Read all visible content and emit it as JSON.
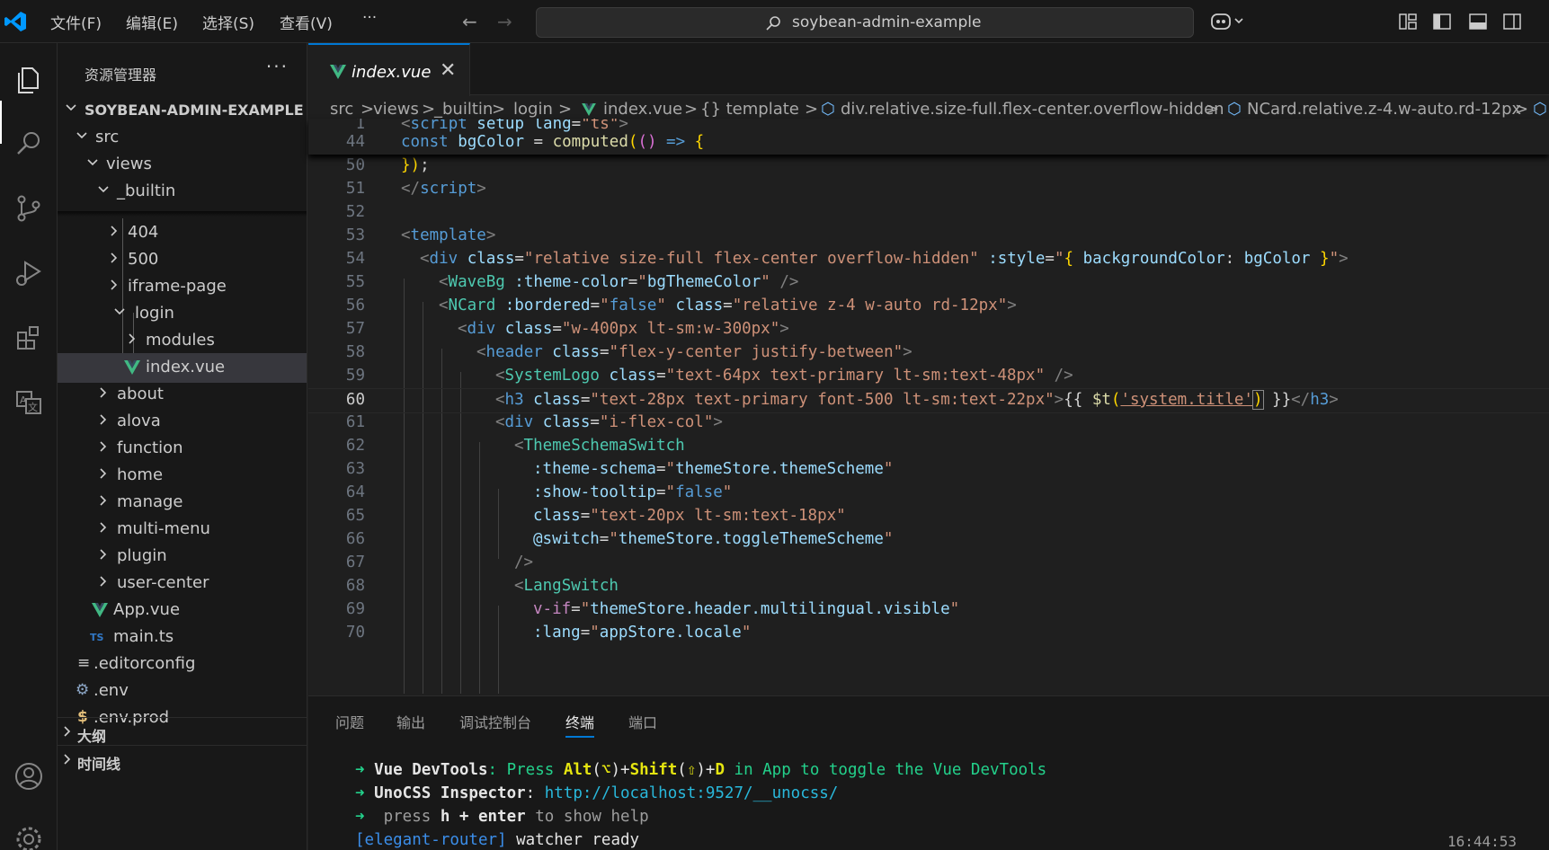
{
  "window": {
    "menu": [
      "文件(F)",
      "编辑(E)",
      "选择(S)",
      "查看(V)"
    ],
    "more": "···",
    "search_text": "soybean-admin-example"
  },
  "sidebar": {
    "title": "资源管理器",
    "more": "···",
    "project": "SOYBEAN-ADMIN-EXAMPLE",
    "items": [
      {
        "label": "src"
      },
      {
        "label": "views"
      },
      {
        "label": "_builtin"
      },
      {
        "label": "404"
      },
      {
        "label": "500"
      },
      {
        "label": "iframe-page"
      },
      {
        "label": "login"
      },
      {
        "label": "modules"
      },
      {
        "label": "index.vue"
      },
      {
        "label": "about"
      },
      {
        "label": "alova"
      },
      {
        "label": "function"
      },
      {
        "label": "home"
      },
      {
        "label": "manage"
      },
      {
        "label": "multi-menu"
      },
      {
        "label": "plugin"
      },
      {
        "label": "user-center"
      },
      {
        "label": "App.vue"
      },
      {
        "label": "main.ts"
      },
      {
        "label": ".editorconfig"
      },
      {
        "label": ".env"
      },
      {
        "label": ".env.prod"
      }
    ],
    "sections": [
      "大纲",
      "时间线"
    ],
    "ts_badge": "TS",
    "env_badge": "$"
  },
  "editor": {
    "tab": "index.vue",
    "tab_close": "✕",
    "breadcrumb": [
      "src",
      ">",
      "views",
      ">",
      "_builtin",
      ">",
      "login",
      ">",
      "index.vue",
      ">",
      "{} template",
      ">",
      "div.relative.size-full.flex-center.overflow-hidden",
      ">",
      "NCard.relative.z-4.w-auto.rd-12px",
      ">"
    ],
    "sticky": [
      {
        "ln": "1"
      },
      {
        "ln": "44"
      }
    ],
    "lines": [
      {
        "ln": "50"
      },
      {
        "ln": "51"
      },
      {
        "ln": "52"
      },
      {
        "ln": "53"
      },
      {
        "ln": "54"
      },
      {
        "ln": "55"
      },
      {
        "ln": "56"
      },
      {
        "ln": "57"
      },
      {
        "ln": "58"
      },
      {
        "ln": "59"
      },
      {
        "ln": "60"
      },
      {
        "ln": "61"
      },
      {
        "ln": "62"
      },
      {
        "ln": "63"
      },
      {
        "ln": "64"
      },
      {
        "ln": "65"
      },
      {
        "ln": "66"
      },
      {
        "ln": "67"
      },
      {
        "ln": "68"
      },
      {
        "ln": "69"
      },
      {
        "ln": "70"
      }
    ],
    "code": {
      "s1": [
        "<",
        "script",
        " setup",
        " lang",
        "=",
        "\"ts\"",
        ">"
      ],
      "s44": [
        "const",
        " bgColor",
        " = ",
        "computed",
        "(",
        "()",
        " => ",
        "{"
      ],
      "l50": [
        "}",
        ")",
        ";"
      ],
      "l51": [
        "</",
        "script",
        ">"
      ],
      "l53": [
        "<",
        "template",
        ">"
      ],
      "l54": [
        "<",
        "div",
        " class",
        "=",
        "\"relative size-full flex-center overflow-hidden\"",
        " :style",
        "=",
        "\"",
        "{",
        " backgroundColor",
        ": ",
        "bgColor",
        " ",
        "}",
        "\"",
        ">"
      ],
      "l55": [
        "<",
        "WaveBg",
        " :theme-color",
        "=",
        "\"",
        "bgThemeColor",
        "\"",
        " />"
      ],
      "l56": [
        "<",
        "NCard",
        " :bordered",
        "=",
        "\"",
        "false",
        "\"",
        " class",
        "=",
        "\"relative z-4 w-auto rd-12px\"",
        ">"
      ],
      "l57": [
        "<",
        "div",
        " class",
        "=",
        "\"w-400px lt-sm:w-300px\"",
        ">"
      ],
      "l58": [
        "<",
        "header",
        " class",
        "=",
        "\"flex-y-center justify-between\"",
        ">"
      ],
      "l59": [
        "<",
        "SystemLogo",
        " class",
        "=",
        "\"text-64px text-primary lt-sm:text-48px\"",
        " />"
      ],
      "l60": [
        "<",
        "h3",
        " class",
        "=",
        "\"text-28px text-primary font-500 lt-sm:text-22px\"",
        ">",
        "{{ ",
        "$t",
        "(",
        "'system.title'",
        ")",
        " }}",
        "</",
        "h3",
        ">"
      ],
      "l61": [
        "<",
        "div",
        " class",
        "=",
        "\"i-flex-col\"",
        ">"
      ],
      "l62": [
        "<",
        "ThemeSchemaSwitch"
      ],
      "l63": [
        ":theme-schema",
        "=",
        "\"",
        "themeStore.themeScheme",
        "\""
      ],
      "l64": [
        ":show-tooltip",
        "=",
        "\"",
        "false",
        "\""
      ],
      "l65": [
        "class",
        "=",
        "\"text-20px lt-sm:text-18px\""
      ],
      "l66": [
        "@switch",
        "=",
        "\"",
        "themeStore.toggleThemeScheme",
        "\""
      ],
      "l67": [
        "/>"
      ],
      "l68": [
        "<",
        "LangSwitch"
      ],
      "l69": [
        "v-if",
        "=",
        "\"",
        "themeStore.header.multilingual.visible",
        "\""
      ],
      "l70": [
        ":lang",
        "=",
        "\"",
        "appStore.locale",
        "\""
      ]
    }
  },
  "panel": {
    "tabs": [
      "问题",
      "输出",
      "调试控制台",
      "终端",
      "端口"
    ],
    "active_tab": "终端",
    "terminal": {
      "l1": [
        "➜ ",
        "Vue DevTools",
        ": Press ",
        "Alt",
        "(",
        "⌥",
        ")+",
        "Shift",
        "(",
        "⇧",
        ")+",
        "D",
        " in App to toggle the Vue DevTools"
      ],
      "l2": [
        "➜ ",
        "UnoCSS Inspector",
        ": ",
        "http://localhost:9527/__unocss/"
      ],
      "l3": [
        "➜ ",
        " press ",
        "h + enter",
        " to show help"
      ],
      "l4": [
        "[elegant-router]",
        " watcher ready"
      ],
      "time": "16:44:53"
    }
  },
  "colors": {
    "accent": "#0078d4",
    "vue_green": "#41b883"
  }
}
